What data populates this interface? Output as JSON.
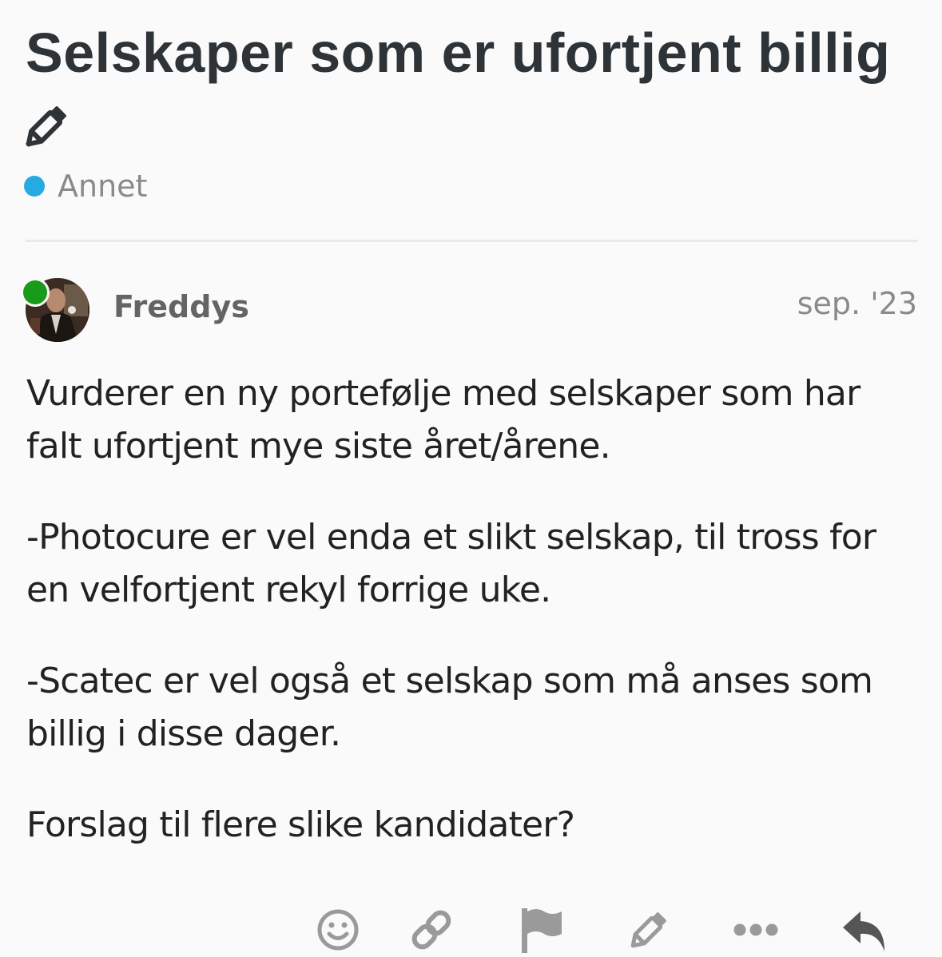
{
  "topic": {
    "title": "Selskaper som er ufortjent billig",
    "category": {
      "name": "Annet",
      "color": "#25aae1"
    }
  },
  "post": {
    "author": "Freddys",
    "date": "sep. '23",
    "online": true,
    "paragraphs": [
      "Vurderer en ny portefølje med selskaper som har falt ufortjent mye siste året/årene.",
      "-Photocure er vel enda et slikt selskap, til tross for en velfortjent rekyl forrige uke.",
      "-Scatec er vel også et selskap som må anses som billig i disse dager.",
      "Forslag til flere slike kandidater?"
    ]
  },
  "actions": [
    {
      "icon": "smile-icon"
    },
    {
      "icon": "link-icon"
    },
    {
      "icon": "flag-icon"
    },
    {
      "icon": "pencil-icon"
    },
    {
      "icon": "ellipsis-icon"
    },
    {
      "icon": "reply-icon"
    }
  ],
  "colors": {
    "title": "#2e3338",
    "muted": "#8a8a8a",
    "username": "#646464",
    "online": "#1a9a1a",
    "icon": "#9a9a9a"
  }
}
